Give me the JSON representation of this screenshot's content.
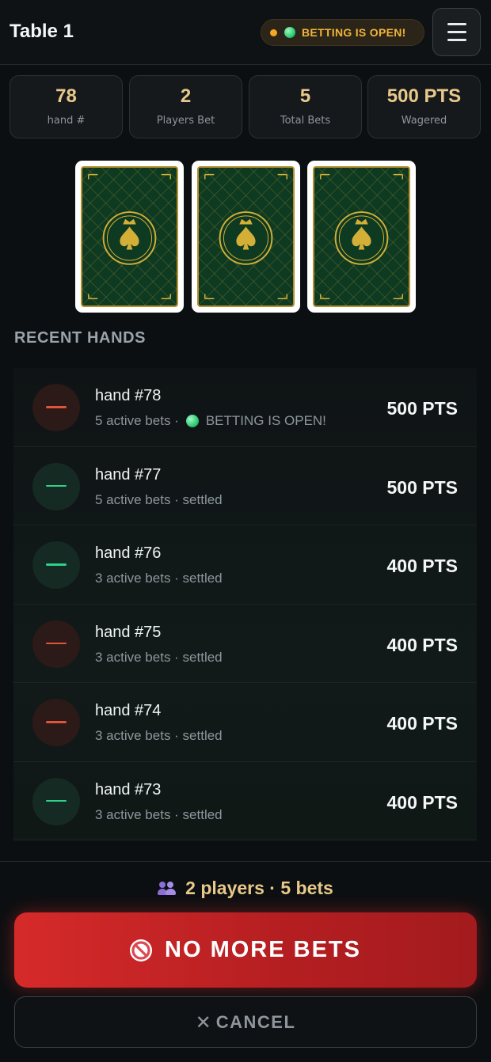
{
  "header": {
    "title": "Table 1",
    "status_text": "BETTING IS OPEN!",
    "menu_icon": "hamburger-menu-icon"
  },
  "stats": [
    {
      "value": "78",
      "label": "hand #"
    },
    {
      "value": "2",
      "label": "Players Bet"
    },
    {
      "value": "5",
      "label": "Total Bets"
    },
    {
      "value": "500 PTS",
      "label": "Wagered"
    }
  ],
  "cards": {
    "count": 3,
    "face": "face-down",
    "back_icon": "crowned-spade-icon"
  },
  "recent_hands": {
    "title": "RECENT HANDS",
    "items": [
      {
        "title": "hand #78",
        "subtitle": "5 active bets ·",
        "status": "BETTING IS OPEN!",
        "amount": "500 PTS",
        "result": "loss"
      },
      {
        "title": "hand #77",
        "subtitle": "5 active bets · settled",
        "status": "",
        "amount": "500 PTS",
        "result": "win"
      },
      {
        "title": "hand #76",
        "subtitle": "3 active bets · settled",
        "status": "",
        "amount": "400 PTS",
        "result": "win"
      },
      {
        "title": "hand #75",
        "subtitle": "3 active bets · settled",
        "status": "",
        "amount": "400 PTS",
        "result": "loss"
      },
      {
        "title": "hand #74",
        "subtitle": "3 active bets · settled",
        "status": "",
        "amount": "400 PTS",
        "result": "loss"
      },
      {
        "title": "hand #73",
        "subtitle": "3 active bets · settled",
        "status": "",
        "amount": "400 PTS",
        "result": "win"
      }
    ]
  },
  "footer": {
    "summary": "2 players · 5 bets",
    "primary_label": "NO MORE BETS",
    "cancel_label": "CANCEL"
  },
  "colors": {
    "accent_gold": "#e8c98a",
    "danger_red": "#d62a2a",
    "win_green": "#2ed18a",
    "loss_red": "#e0543b",
    "status_amber": "#f0b43a"
  }
}
